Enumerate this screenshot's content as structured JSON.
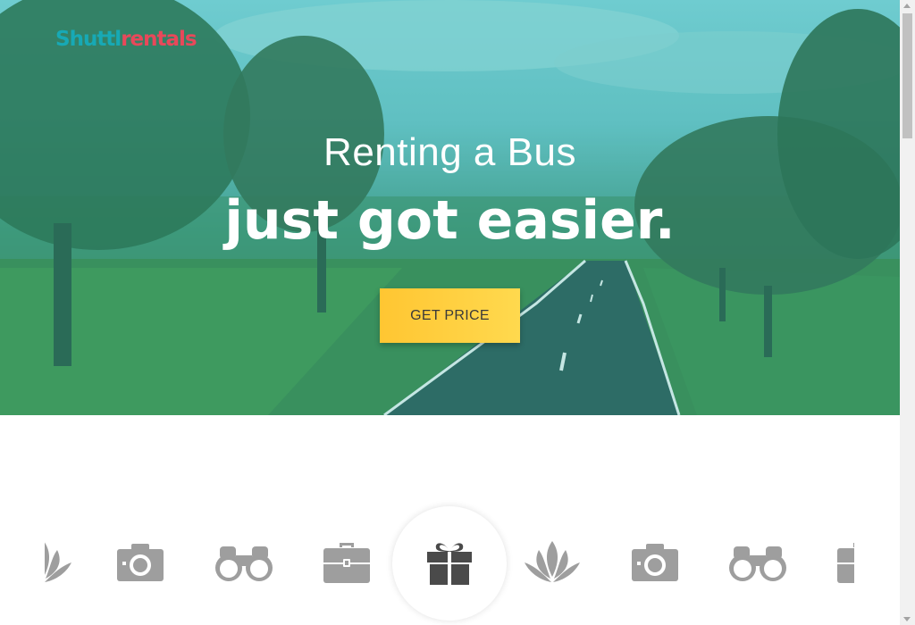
{
  "brand": {
    "logo_part1": "Shuttl",
    "logo_part2": "rentals",
    "color_primary": "#17a9b5",
    "color_secondary": "#e8485a"
  },
  "hero": {
    "headline_line1": "Renting a Bus",
    "headline_line2": "just got easier.",
    "cta_label": "GET PRICE",
    "cta_color": "#ffc632"
  },
  "carousel": {
    "icons": [
      {
        "name": "lotus-icon",
        "active": false
      },
      {
        "name": "camera-icon",
        "active": false
      },
      {
        "name": "binoculars-icon",
        "active": false
      },
      {
        "name": "briefcase-icon",
        "active": false
      },
      {
        "name": "gift-icon",
        "active": true
      },
      {
        "name": "lotus-icon",
        "active": false
      },
      {
        "name": "camera-icon",
        "active": false
      },
      {
        "name": "binoculars-icon",
        "active": false
      },
      {
        "name": "briefcase-icon",
        "active": false
      }
    ],
    "icon_color": "#9e9e9e",
    "active_icon_color": "#4a4a4a"
  }
}
